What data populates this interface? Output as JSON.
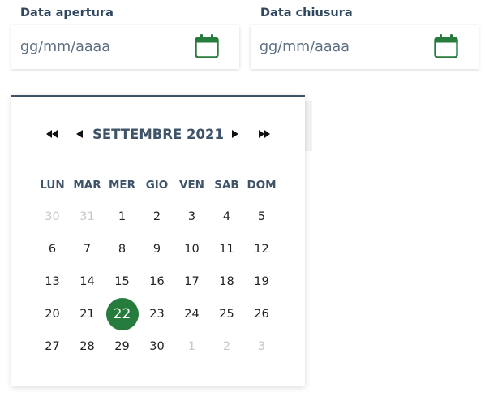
{
  "colors": {
    "accent": "#267c3c",
    "header": "#3f5469",
    "label": "#2f475e"
  },
  "fields": {
    "open": {
      "label": "Data apertura",
      "placeholder": "gg/mm/aaaa",
      "value": "",
      "icon": "calendar-icon"
    },
    "close": {
      "label": "Data chiusura",
      "placeholder": "gg/mm/aaaa",
      "value": "",
      "icon": "calendar-icon"
    }
  },
  "calendar": {
    "month_label": "SETTEMBRE 2021",
    "nav_icons": [
      "double-chevron-left-icon",
      "chevron-left-icon",
      "chevron-right-icon",
      "double-chevron-right-icon"
    ],
    "weekdays": [
      "LUN",
      "MAR",
      "MER",
      "GIO",
      "VEN",
      "SAB",
      "DOM"
    ],
    "days": [
      {
        "label": "30",
        "outside": true
      },
      {
        "label": "31",
        "outside": true
      },
      {
        "label": "1"
      },
      {
        "label": "2"
      },
      {
        "label": "3"
      },
      {
        "label": "4"
      },
      {
        "label": "5"
      },
      {
        "label": "6"
      },
      {
        "label": "7"
      },
      {
        "label": "8"
      },
      {
        "label": "9"
      },
      {
        "label": "10"
      },
      {
        "label": "11"
      },
      {
        "label": "12"
      },
      {
        "label": "13"
      },
      {
        "label": "14"
      },
      {
        "label": "15"
      },
      {
        "label": "16"
      },
      {
        "label": "17"
      },
      {
        "label": "18"
      },
      {
        "label": "19"
      },
      {
        "label": "20"
      },
      {
        "label": "21"
      },
      {
        "label": "22",
        "selected": true
      },
      {
        "label": "23"
      },
      {
        "label": "24"
      },
      {
        "label": "25"
      },
      {
        "label": "26"
      },
      {
        "label": "27"
      },
      {
        "label": "28"
      },
      {
        "label": "29"
      },
      {
        "label": "30"
      },
      {
        "label": "1",
        "outside": true
      },
      {
        "label": "2",
        "outside": true
      },
      {
        "label": "3",
        "outside": true
      }
    ]
  }
}
